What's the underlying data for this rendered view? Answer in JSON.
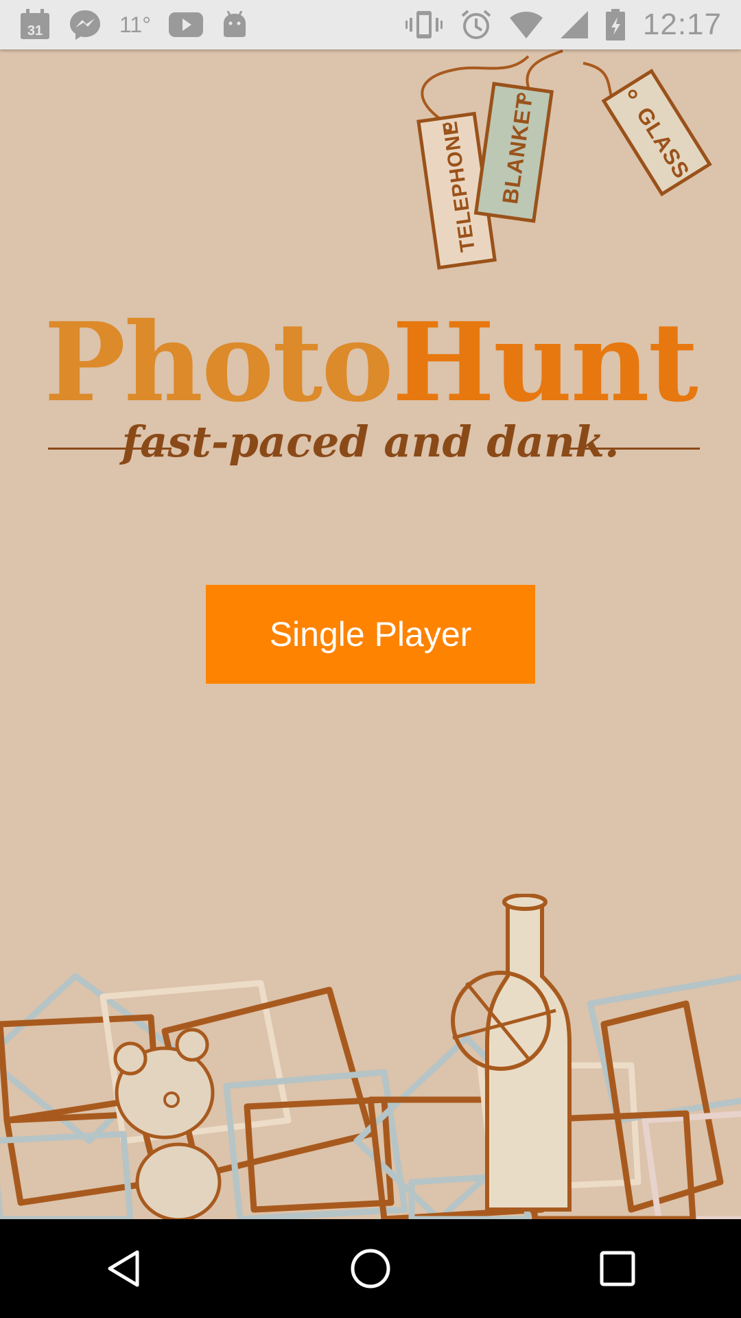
{
  "status_bar": {
    "temperature": "11°",
    "time": "12:17",
    "calendar_day": "31",
    "icons_left": [
      "calendar-icon",
      "messenger-icon",
      "youtube-icon",
      "android-icon"
    ],
    "icons_right": [
      "vibrate-icon",
      "alarm-icon",
      "wifi-icon",
      "signal-icon",
      "battery-charging-icon"
    ]
  },
  "tags": [
    "TELEPHONE",
    "BLANKET",
    "GLASS"
  ],
  "logo": {
    "title_part1": "Photo",
    "title_part2": "Hunt",
    "tagline": "fast-paced and dank."
  },
  "main": {
    "single_player_label": "Single Player"
  },
  "colors": {
    "background": "#dcc3ab",
    "button": "#fe8300",
    "button_text": "#ffffff",
    "logo_orange": "#dc8a2a",
    "logo_accent": "#e7780f",
    "tagline_brown": "#8a4a18",
    "status_bar": "#e9e9e9",
    "nav_bar": "#000000"
  },
  "nav_bar": {
    "buttons": [
      "back-icon",
      "home-icon",
      "recents-icon"
    ]
  }
}
